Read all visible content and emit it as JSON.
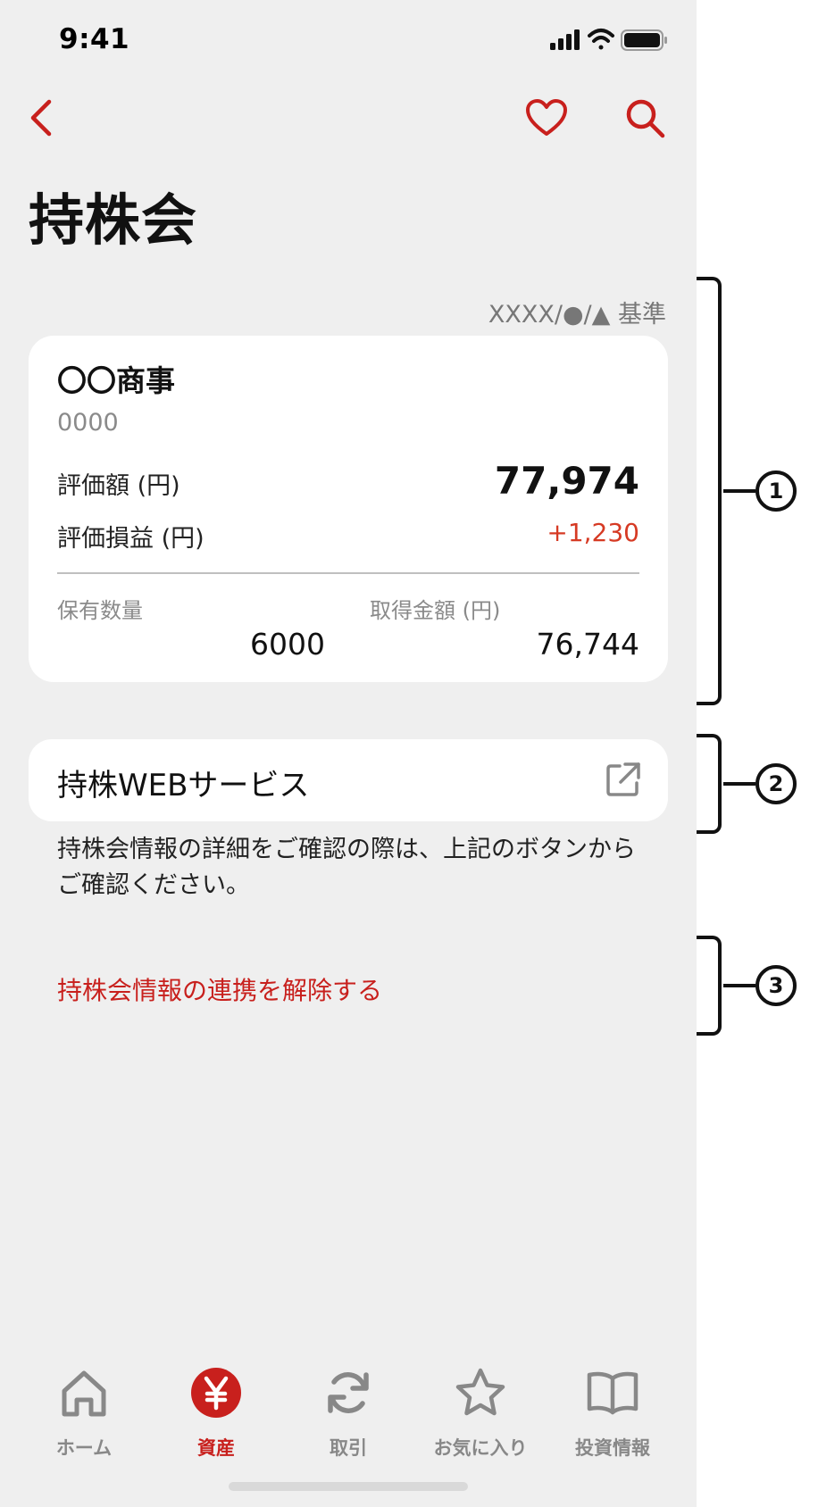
{
  "status_bar": {
    "time": "9:41"
  },
  "header": {
    "title": "持株会"
  },
  "holding": {
    "as_of": "XXXX/●/▲ 基準",
    "company": "〇〇商事",
    "code": "0000",
    "valuation_label": "評価額 (円)",
    "valuation_value": "77,974",
    "pnl_label": "評価損益 (円)",
    "pnl_value": "+1,230",
    "quantity_label": "保有数量",
    "quantity_value": "6000",
    "cost_label": "取得金額 (円)",
    "cost_value": "76,744"
  },
  "web_service": {
    "label": "持株WEBサービス",
    "note": "持株会情報の詳細をご確認の際は、上記のボタンからご確認ください。"
  },
  "unlink_label": "持株会情報の連携を解除する",
  "tabbar": {
    "items": [
      {
        "label": "ホーム",
        "icon": "home-icon"
      },
      {
        "label": "資産",
        "icon": "yen-icon",
        "active": true
      },
      {
        "label": "取引",
        "icon": "refresh-icon"
      },
      {
        "label": "お気に入り",
        "icon": "star-icon"
      },
      {
        "label": "投資情報",
        "icon": "book-icon"
      }
    ]
  },
  "annotations": [
    "1",
    "2",
    "3"
  ],
  "colors": {
    "accent": "#c8201d",
    "gain": "#d63a24",
    "background": "#efefef",
    "card": "#ffffff"
  }
}
